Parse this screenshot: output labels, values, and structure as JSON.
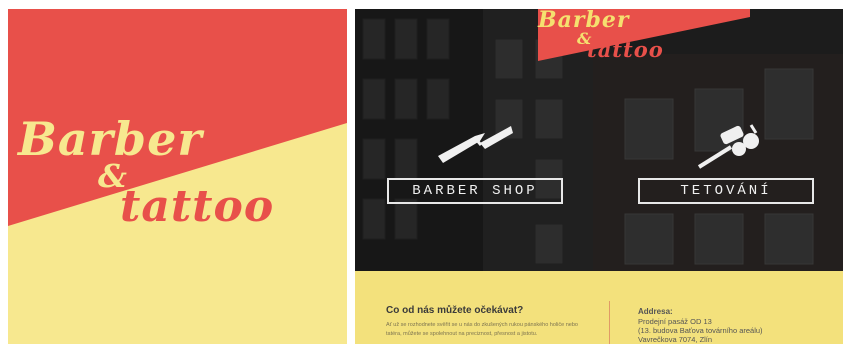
{
  "logo": {
    "line1": "Barber",
    "amp": "&",
    "line2": "tattoo"
  },
  "small_logo": {
    "line1": "Barber",
    "amp": "&",
    "line2": "tattoo"
  },
  "nav": {
    "barber_label": "BARBER SHOP",
    "tattoo_label": "TETOVÁNÍ"
  },
  "info": {
    "title": "Co od nás můžete očekávat?",
    "text": "Ať už se rozhodnete svěřit se u nás do zkušených rukou pánského holiče nebo tatéra, můžete se spolehnout na preciznost, přesnost a jistotu.",
    "address_label": "Addresa:",
    "address_lines": [
      "Prodejní pasáž OD 13",
      "(13. budova Baťova továrního areálu)",
      "Vavrečkova 7074, Zlín"
    ]
  },
  "colors": {
    "red": "#e8504a",
    "yellow": "#f7e88f",
    "dark": "#242424",
    "info_bg": "#f3e17c"
  }
}
